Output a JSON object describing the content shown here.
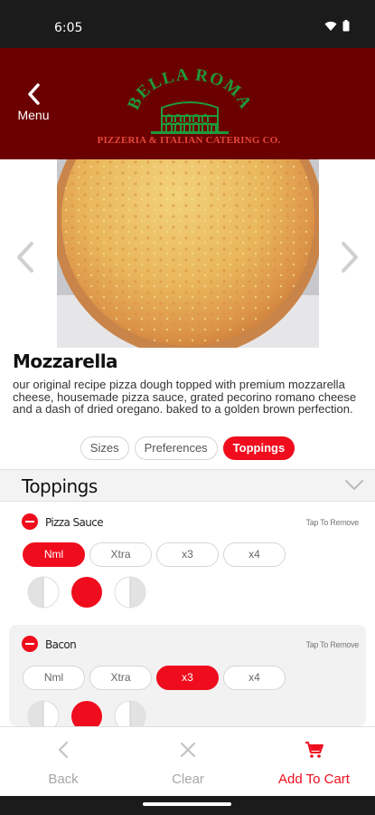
{
  "status_bar": {
    "time": "6:05",
    "icons": [
      "wifi-icon",
      "battery-icon"
    ]
  },
  "header": {
    "menu_label": "Menu",
    "logo_name": "BELLA ROMA",
    "logo_tagline": "PIZZERIA & ITALIAN CATERING CO.",
    "background_color": "#6b0000"
  },
  "item": {
    "title": "Mozzarella",
    "description": "our original recipe pizza dough topped with premium mozzarella cheese, housemade pizza sauce, grated pecorino romano cheese and a dash of dried oregano. baked to a golden brown perfection."
  },
  "tabs": [
    {
      "label": "Sizes",
      "active": false
    },
    {
      "label": "Preferences",
      "active": false
    },
    {
      "label": "Toppings",
      "active": true
    }
  ],
  "section": {
    "title": "Toppings"
  },
  "toppings": [
    {
      "name": "Pizza Sauce",
      "tap_to_remove": "Tap To Remove",
      "quantities": [
        "Nml",
        "Xtra",
        "x3",
        "x4"
      ],
      "selected_quantity": "Nml",
      "selected_portion": "whole"
    },
    {
      "name": "Bacon",
      "tap_to_remove": "Tap To Remove",
      "quantities": [
        "Nml",
        "Xtra",
        "x3",
        "x4"
      ],
      "selected_quantity": "x3",
      "selected_portion": "whole"
    }
  ],
  "actions": {
    "back_label": "Back",
    "clear_label": "Clear",
    "cart_label": "Add To Cart"
  },
  "colors": {
    "accent": "#ef0c1d",
    "inactive": "#a8a8a8"
  }
}
